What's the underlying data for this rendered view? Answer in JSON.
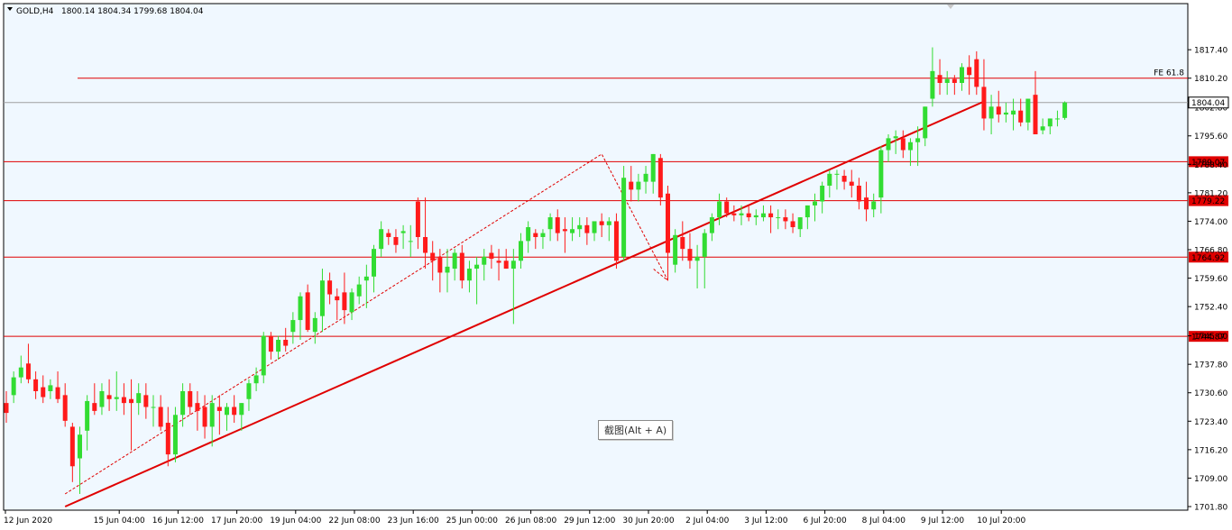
{
  "header": {
    "symbol": "GOLD,H4",
    "ohlc": "1800.14 1804.34 1799.68 1804.04"
  },
  "tooltip": "截图(Alt + A)",
  "fe_label": "FE 61.8",
  "current_price": "1804.04",
  "colors": {
    "background": "#f0f8ff",
    "bull": "#32dc32",
    "bear": "#ff1a1a",
    "level": "#e00000",
    "trend": "#e00000",
    "current_line": "#a0a0a0"
  },
  "chart_data": {
    "type": "candlestick",
    "symbol": "GOLD",
    "timeframe": "H4",
    "ylim": [
      1701.8,
      1822.0
    ],
    "y_ticks": [
      1701.8,
      1709.0,
      1716.2,
      1723.4,
      1730.6,
      1737.8,
      1745.0,
      1752.4,
      1759.6,
      1766.8,
      1774.0,
      1781.2,
      1788.4,
      1795.6,
      1802.8,
      1810.2,
      1817.4
    ],
    "x_ticks": [
      {
        "index": 0,
        "label": "12 Jun 2020"
      },
      {
        "index": 8,
        "label": "15 Jun 04:00"
      },
      {
        "index": 16,
        "label": "16 Jun 12:00"
      },
      {
        "index": 24,
        "label": "17 Jun 20:00"
      },
      {
        "index": 32,
        "label": "19 Jun 04:00"
      },
      {
        "index": 40,
        "label": "22 Jun 08:00"
      },
      {
        "index": 48,
        "label": "23 Jun 16:00"
      },
      {
        "index": 56,
        "label": "25 Jun 00:00"
      },
      {
        "index": 64,
        "label": "26 Jun 08:00"
      },
      {
        "index": 72,
        "label": "29 Jun 12:00"
      },
      {
        "index": 80,
        "label": "30 Jun 20:00"
      },
      {
        "index": 88,
        "label": "2 Jul 04:00"
      },
      {
        "index": 96,
        "label": "3 Jul 12:00"
      },
      {
        "index": 104,
        "label": "6 Jul 20:00"
      },
      {
        "index": 112,
        "label": "8 Jul 04:00"
      },
      {
        "index": 120,
        "label": "9 Jul 12:00"
      },
      {
        "index": 128,
        "label": "10 Jul 20:00"
      }
    ],
    "candles": [
      [
        1728.0,
        1731.0,
        1723.0,
        1725.5
      ],
      [
        1730.0,
        1736.0,
        1728.0,
        1734.5
      ],
      [
        1734.5,
        1740.0,
        1733.0,
        1737.0
      ],
      [
        1738.0,
        1743.0,
        1733.0,
        1734.0
      ],
      [
        1734.0,
        1736.0,
        1729.0,
        1731.0
      ],
      [
        1732.0,
        1735.0,
        1728.0,
        1729.5
      ],
      [
        1731.0,
        1734.0,
        1729.0,
        1732.5
      ],
      [
        1732.0,
        1736.0,
        1728.0,
        1729.0
      ],
      [
        1730.0,
        1733.0,
        1722.0,
        1723.5
      ],
      [
        1722.0,
        1723.0,
        1708.0,
        1712.0
      ],
      [
        1714.0,
        1722.0,
        1705.0,
        1720.0
      ],
      [
        1721.0,
        1730.0,
        1716.0,
        1728.5
      ],
      [
        1728.0,
        1733.0,
        1725.0,
        1726.0
      ],
      [
        1727.0,
        1733.0,
        1725.0,
        1731.0
      ],
      [
        1730.0,
        1734.0,
        1726.0,
        1729.0
      ],
      [
        1729.0,
        1736.0,
        1726.0,
        1729.5
      ],
      [
        1729.5,
        1733.0,
        1725.0,
        1728.0
      ],
      [
        1729.0,
        1734.0,
        1716.0,
        1728.0
      ],
      [
        1728.0,
        1733.0,
        1725.0,
        1730.5
      ],
      [
        1730.0,
        1733.0,
        1724.0,
        1727.0
      ],
      [
        1727.0,
        1730.0,
        1722.0,
        1727.0
      ],
      [
        1727.0,
        1730.0,
        1721.0,
        1722.0
      ],
      [
        1723.0,
        1727.0,
        1712.0,
        1715.0
      ],
      [
        1715.0,
        1727.0,
        1713.0,
        1725.0
      ],
      [
        1725.0,
        1733.0,
        1722.0,
        1731.0
      ],
      [
        1731.0,
        1733.0,
        1725.0,
        1727.0
      ],
      [
        1728.0,
        1731.0,
        1721.0,
        1726.0
      ],
      [
        1727.0,
        1730.0,
        1719.0,
        1722.0
      ],
      [
        1722.0,
        1730.0,
        1717.0,
        1728.0
      ],
      [
        1727.0,
        1730.0,
        1720.0,
        1726.0
      ],
      [
        1725.0,
        1728.0,
        1721.0,
        1727.0
      ],
      [
        1727.0,
        1730.0,
        1723.0,
        1725.0
      ],
      [
        1725.0,
        1728.0,
        1721.0,
        1728.0
      ],
      [
        1729.0,
        1734.0,
        1726.0,
        1733.0
      ],
      [
        1733.0,
        1737.0,
        1731.0,
        1735.0
      ],
      [
        1735.0,
        1746.0,
        1733.0,
        1745.0
      ],
      [
        1745.0,
        1746.0,
        1739.0,
        1741.0
      ],
      [
        1741.0,
        1745.0,
        1739.0,
        1744.0
      ],
      [
        1744.0,
        1747.0,
        1741.0,
        1742.5
      ],
      [
        1746.0,
        1751.0,
        1743.0,
        1749.0
      ],
      [
        1749.0,
        1756.0,
        1744.0,
        1755.0
      ],
      [
        1756.0,
        1758.0,
        1746.0,
        1746.5
      ],
      [
        1746.0,
        1751.0,
        1743.0,
        1749.5
      ],
      [
        1750.0,
        1762.0,
        1746.0,
        1759.0
      ],
      [
        1759.0,
        1761.0,
        1753.0,
        1755.5
      ],
      [
        1755.0,
        1757.0,
        1749.0,
        1754.0
      ],
      [
        1756.0,
        1761.0,
        1748.0,
        1751.5
      ],
      [
        1751.0,
        1757.0,
        1749.0,
        1756.0
      ],
      [
        1755.0,
        1760.0,
        1753.0,
        1758.0
      ],
      [
        1759.0,
        1763.0,
        1752.0,
        1760.0
      ],
      [
        1760.0,
        1768.0,
        1756.0,
        1767.0
      ],
      [
        1767.0,
        1774.0,
        1765.0,
        1772.0
      ],
      [
        1771.0,
        1772.0,
        1768.0,
        1770.0
      ],
      [
        1770.0,
        1772.0,
        1766.0,
        1768.0
      ],
      [
        1771.0,
        1773.0,
        1767.0,
        1771.5
      ],
      [
        1769.0,
        1773.0,
        1765.0,
        1769.0
      ],
      [
        1779.0,
        1780.0,
        1767.0,
        1770.0
      ],
      [
        1770.0,
        1780.0,
        1762.0,
        1766.0
      ],
      [
        1766.0,
        1769.0,
        1759.0,
        1764.0
      ],
      [
        1765.0,
        1767.0,
        1756.0,
        1761.0
      ],
      [
        1761.0,
        1767.0,
        1756.0,
        1762.5
      ],
      [
        1762.0,
        1767.0,
        1759.0,
        1766.0
      ],
      [
        1766.0,
        1768.0,
        1757.0,
        1759.0
      ],
      [
        1759.0,
        1764.0,
        1756.0,
        1762.0
      ],
      [
        1762.0,
        1765.0,
        1753.0,
        1763.0
      ],
      [
        1763.0,
        1767.0,
        1759.0,
        1765.0
      ],
      [
        1766.0,
        1768.0,
        1762.0,
        1764.5
      ],
      [
        1764.0,
        1767.0,
        1759.0,
        1763.5
      ],
      [
        1764.0,
        1767.0,
        1762.0,
        1762.0
      ],
      [
        1762.0,
        1767.0,
        1748.0,
        1764.0
      ],
      [
        1764.0,
        1771.0,
        1762.0,
        1769.0
      ],
      [
        1769.0,
        1774.0,
        1766.0,
        1772.5
      ],
      [
        1771.0,
        1772.0,
        1767.0,
        1770.0
      ],
      [
        1770.0,
        1772.0,
        1767.0,
        1771.0
      ],
      [
        1772.0,
        1776.0,
        1769.0,
        1775.0
      ],
      [
        1775.0,
        1777.0,
        1769.0,
        1771.0
      ],
      [
        1772.0,
        1775.0,
        1766.0,
        1771.5
      ],
      [
        1771.0,
        1775.0,
        1769.0,
        1772.0
      ],
      [
        1772.0,
        1775.0,
        1770.0,
        1773.0
      ],
      [
        1773.0,
        1775.0,
        1768.0,
        1771.0
      ],
      [
        1771.0,
        1774.0,
        1769.0,
        1774.0
      ],
      [
        1774.0,
        1776.0,
        1770.0,
        1773.0
      ],
      [
        1773.0,
        1775.0,
        1769.0,
        1774.0
      ],
      [
        1774.0,
        1776.0,
        1762.0,
        1764.0
      ],
      [
        1765.0,
        1788.0,
        1764.0,
        1785.0
      ],
      [
        1784.0,
        1788.0,
        1779.0,
        1782.0
      ],
      [
        1782.0,
        1786.0,
        1779.0,
        1784.0
      ],
      [
        1784.0,
        1788.0,
        1781.0,
        1786.0
      ],
      [
        1784.0,
        1791.0,
        1781.0,
        1791.0
      ],
      [
        1790.0,
        1791.0,
        1778.0,
        1780.0
      ],
      [
        1781.0,
        1783.0,
        1759.0,
        1766.0
      ],
      [
        1763.0,
        1772.0,
        1761.0,
        1770.5
      ],
      [
        1770.0,
        1774.0,
        1764.0,
        1767.0
      ],
      [
        1767.0,
        1771.0,
        1762.0,
        1764.0
      ],
      [
        1764.0,
        1768.0,
        1757.0,
        1765.0
      ],
      [
        1765.0,
        1772.0,
        1757.0,
        1771.0
      ],
      [
        1771.0,
        1776.0,
        1769.0,
        1775.0
      ],
      [
        1775.0,
        1781.0,
        1773.0,
        1779.0
      ],
      [
        1779.0,
        1780.0,
        1775.0,
        1776.0
      ],
      [
        1776.0,
        1778.0,
        1774.0,
        1775.5
      ],
      [
        1775.5,
        1778.0,
        1773.0,
        1776.0
      ],
      [
        1776.0,
        1778.0,
        1774.0,
        1775.0
      ],
      [
        1775.0,
        1777.0,
        1773.0,
        1775.5
      ],
      [
        1775.0,
        1778.0,
        1774.0,
        1776.0
      ],
      [
        1776.0,
        1778.0,
        1771.0,
        1775.0
      ],
      [
        1775.0,
        1777.0,
        1772.0,
        1775.0
      ],
      [
        1775.0,
        1777.0,
        1772.0,
        1774.0
      ],
      [
        1774.0,
        1776.0,
        1771.0,
        1772.5
      ],
      [
        1772.0,
        1775.0,
        1770.0,
        1775.0
      ],
      [
        1775.0,
        1778.0,
        1772.0,
        1778.0
      ],
      [
        1778.0,
        1781.0,
        1774.0,
        1779.0
      ],
      [
        1779.0,
        1784.0,
        1776.0,
        1783.0
      ],
      [
        1783.0,
        1787.0,
        1780.0,
        1786.0
      ],
      [
        1786.0,
        1787.0,
        1782.0,
        1786.0
      ],
      [
        1785.5,
        1787.0,
        1782.0,
        1784.0
      ],
      [
        1784.0,
        1787.0,
        1780.0,
        1783.0
      ],
      [
        1783.0,
        1785.0,
        1777.0,
        1779.0
      ],
      [
        1780.0,
        1784.0,
        1774.0,
        1777.0
      ],
      [
        1777.0,
        1781.0,
        1775.0,
        1779.0
      ],
      [
        1780.0,
        1793.0,
        1776.0,
        1792.0
      ],
      [
        1792.0,
        1796.0,
        1789.0,
        1795.0
      ],
      [
        1795.0,
        1797.0,
        1791.0,
        1795.5
      ],
      [
        1795.0,
        1797.0,
        1790.0,
        1792.0
      ],
      [
        1792.0,
        1795.0,
        1788.0,
        1794.0
      ],
      [
        1794.0,
        1798.0,
        1788.0,
        1795.0
      ],
      [
        1795.0,
        1803.0,
        1793.0,
        1803.0
      ],
      [
        1805.0,
        1818.0,
        1803.0,
        1812.0
      ],
      [
        1811.0,
        1815.0,
        1806.0,
        1809.0
      ],
      [
        1809.0,
        1812.0,
        1806.0,
        1810.0
      ],
      [
        1810.0,
        1811.0,
        1806.0,
        1809.0
      ],
      [
        1809.0,
        1814.0,
        1807.0,
        1813.0
      ],
      [
        1813.0,
        1816.0,
        1806.0,
        1811.0
      ],
      [
        1815.0,
        1817.0,
        1806.0,
        1808.0
      ],
      [
        1808.0,
        1815.0,
        1797.0,
        1800.0
      ],
      [
        1800.0,
        1806.0,
        1796.0,
        1803.0
      ],
      [
        1803.0,
        1807.0,
        1799.0,
        1801.0
      ],
      [
        1801.0,
        1804.0,
        1799.0,
        1801.5
      ],
      [
        1801.0,
        1805.0,
        1797.0,
        1802.0
      ],
      [
        1802.0,
        1805.0,
        1798.0,
        1799.0
      ],
      [
        1799.0,
        1805.0,
        1797.0,
        1805.0
      ],
      [
        1806.0,
        1812.0,
        1801.0,
        1796.0
      ],
      [
        1797.0,
        1800.0,
        1796.0,
        1798.0
      ],
      [
        1798.0,
        1800.0,
        1796.0,
        1800.0
      ],
      [
        1800.0,
        1802.0,
        1798.0,
        1800.0
      ],
      [
        1800.14,
        1804.34,
        1799.68,
        1804.04
      ]
    ],
    "horizontal_levels": [
      {
        "price": 1789.07,
        "label": "1789.07"
      },
      {
        "price": 1779.22,
        "label": "1779.22"
      },
      {
        "price": 1764.92,
        "label": "1764.92"
      },
      {
        "price": 1744.87,
        "label": "1744.87"
      }
    ],
    "fibo_expansion": {
      "price": 1810.2,
      "label": "FE 61.8"
    },
    "trendline": {
      "from": [
        8,
        1701.8
      ],
      "to": [
        133,
        1804.3
      ]
    },
    "zigzag": [
      [
        8,
        1705.0
      ],
      [
        81,
        1791.0
      ],
      [
        90,
        1759.0
      ],
      [
        88,
        1762.0
      ]
    ],
    "grid": false,
    "legend": "none"
  }
}
